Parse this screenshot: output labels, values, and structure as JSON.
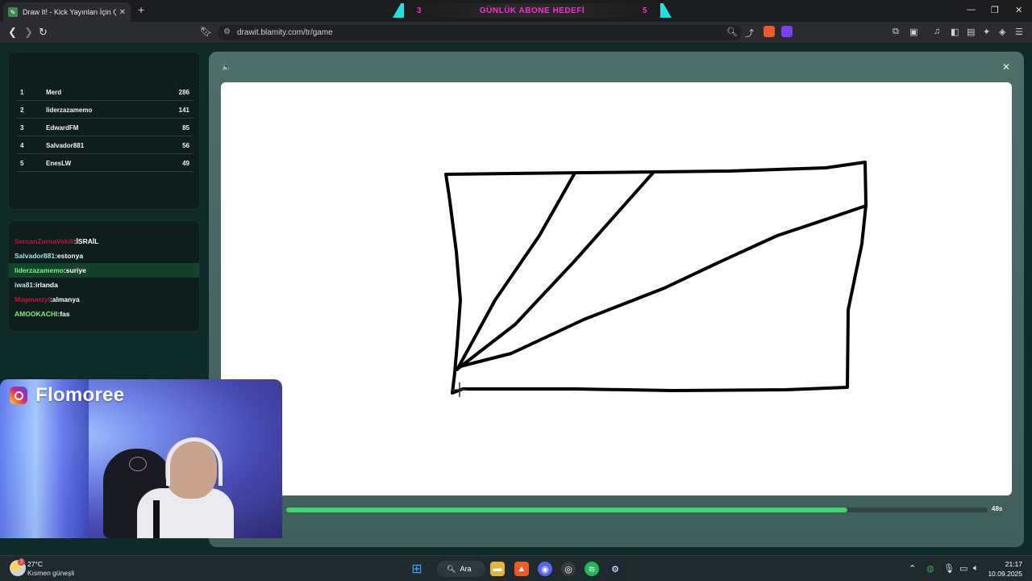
{
  "browser": {
    "tab_title": "Draw It! - Kick Yayınları İçin Çizim",
    "tab_close": "✕",
    "new_tab": "+",
    "url": "drawit.blamity.com/tr/game",
    "banner": {
      "left": "3",
      "center": "GÜNLÜK ABONE HEDEFİ",
      "right": "5"
    },
    "window_controls": {
      "minimize": "—",
      "maximize": "❐",
      "close": "✕"
    }
  },
  "leaderboard": [
    {
      "rank": "1",
      "name": "Merd",
      "score": "286"
    },
    {
      "rank": "2",
      "name": "liderzazamemo",
      "score": "141"
    },
    {
      "rank": "3",
      "name": "EdwardFM",
      "score": "85"
    },
    {
      "rank": "4",
      "name": "Salvador881",
      "score": "56"
    },
    {
      "rank": "5",
      "name": "EnesLW",
      "score": "49"
    }
  ],
  "chat": [
    {
      "user": "SercanZurnaVekili",
      "message": ":İSRAİL",
      "color": "#c2123d",
      "highlight": false
    },
    {
      "user": "Salvador881",
      "message": ":estonya",
      "color": "#9fe4ee",
      "highlight": false
    },
    {
      "user": "liderzazamemo",
      "message": ":suriye",
      "color": "#7ef07a",
      "highlight": true
    },
    {
      "user": "iwa81",
      "message": ":irlanda",
      "color": "#bfe2ea",
      "highlight": false
    },
    {
      "user": "Magmastyl",
      "message": ":almanya",
      "color": "#c2123d",
      "highlight": false
    },
    {
      "user": "AMOOKACHI",
      "message": ":fas",
      "color": "#7ef07a",
      "highlight": false
    }
  ],
  "webcam": {
    "name": "Flomoree"
  },
  "game": {
    "progress": 0.8,
    "timer": "48s",
    "speaker_icon": "🔈",
    "close_icon": "✕"
  },
  "taskbar": {
    "temperature": "27°C",
    "condition": "Kısmen güneşli",
    "weather_badge": "2",
    "search_label": "Ara",
    "time": "21:17",
    "date": "10.09.2025"
  }
}
